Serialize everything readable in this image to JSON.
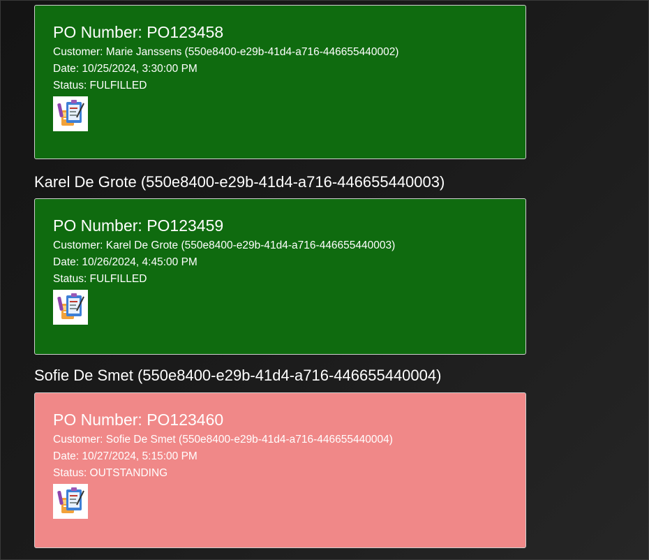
{
  "orders": [
    {
      "po_label": "PO Number: PO123458",
      "customer_line": "Customer: Marie Janssens (550e8400-e29b-41d4-a716-446655440002)",
      "date_line": "Date: 10/25/2024, 3:30:00 PM",
      "status_line": "Status: FULFILLED",
      "status": "FULFILLED",
      "color": "#0f6b0f",
      "icon": "clipboard-order-icon"
    },
    {
      "heading": "Karel De Grote (550e8400-e29b-41d4-a716-446655440003)",
      "po_label": "PO Number: PO123459",
      "customer_line": "Customer: Karel De Grote (550e8400-e29b-41d4-a716-446655440003)",
      "date_line": "Date: 10/26/2024, 4:45:00 PM",
      "status_line": "Status: FULFILLED",
      "status": "FULFILLED",
      "color": "#0f6b0f",
      "icon": "clipboard-order-icon"
    },
    {
      "heading": "Sofie De Smet (550e8400-e29b-41d4-a716-446655440004)",
      "po_label": "PO Number: PO123460",
      "customer_line": "Customer: Sofie De Smet (550e8400-e29b-41d4-a716-446655440004)",
      "date_line": "Date: 10/27/2024, 5:15:00 PM",
      "status_line": "Status: OUTSTANDING",
      "status": "OUTSTANDING",
      "color": "#f08888",
      "icon": "clipboard-order-icon"
    }
  ]
}
